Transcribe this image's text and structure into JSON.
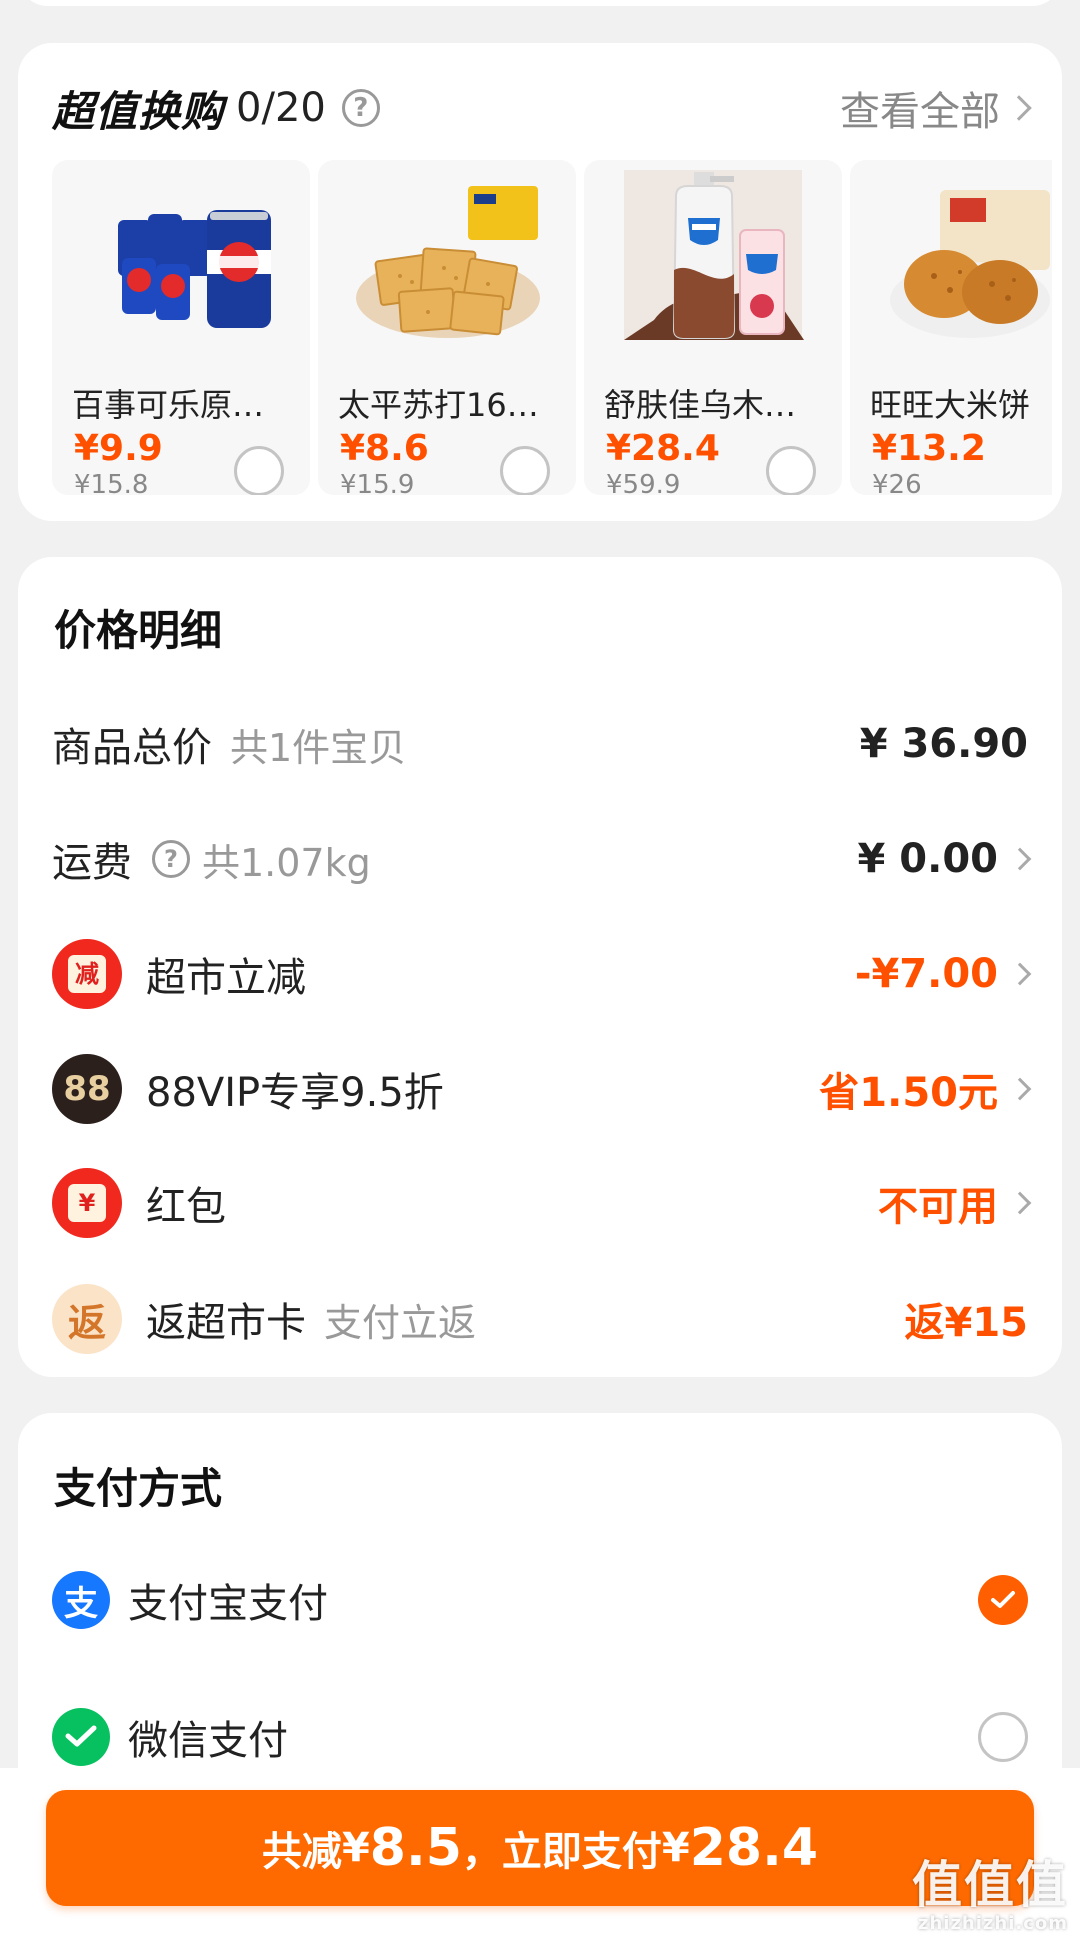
{
  "exchange": {
    "title": "超值换购",
    "count": "0/20",
    "help": "?",
    "view_all": "查看全部",
    "products": [
      {
        "name": "百事可乐原…",
        "price": "¥9.9",
        "original": "¥15.8"
      },
      {
        "name": "太平苏打16…",
        "price": "¥8.6",
        "original": "¥15.9"
      },
      {
        "name": "舒肤佳乌木…",
        "price": "¥28.4",
        "original": "¥59.9"
      },
      {
        "name": "旺旺大米饼",
        "price": "¥13.2",
        "original": "¥26"
      }
    ]
  },
  "price_detail": {
    "title": "价格明细",
    "rows": [
      {
        "label": "商品总价",
        "sub": "共1件宝贝",
        "value": "¥ 36.90"
      },
      {
        "label": "运费",
        "sub": "共1.07kg",
        "value": "¥ 0.00"
      },
      {
        "label": "超市立减",
        "icon_text": "减",
        "value": "-¥7.00"
      },
      {
        "label": "88VIP专享9.5折",
        "icon_text": "88",
        "value": "省1.50元"
      },
      {
        "label": "红包",
        "icon_text": "¥",
        "value": "不可用"
      },
      {
        "label": "返超市卡",
        "sub": "支付立返",
        "icon_text": "返",
        "value": "返¥15"
      }
    ]
  },
  "payment": {
    "title": "支付方式",
    "methods": [
      {
        "name": "支付宝支付",
        "icon_text": "支",
        "selected": true
      },
      {
        "name": "微信支付",
        "selected": false
      }
    ]
  },
  "bottom": {
    "pay_prefix": "共减",
    "pay_currency1": "¥",
    "pay_saved": "8.5",
    "pay_mid": "，立即支付",
    "pay_currency2": "¥",
    "pay_total": "28.4"
  },
  "watermark": {
    "main": "值值值",
    "sub": "zhizhizhi.com"
  },
  "colors": {
    "accent": "#ff5000",
    "button": "#ff6a00",
    "alipay": "#1677ff",
    "wechat": "#07c160"
  }
}
